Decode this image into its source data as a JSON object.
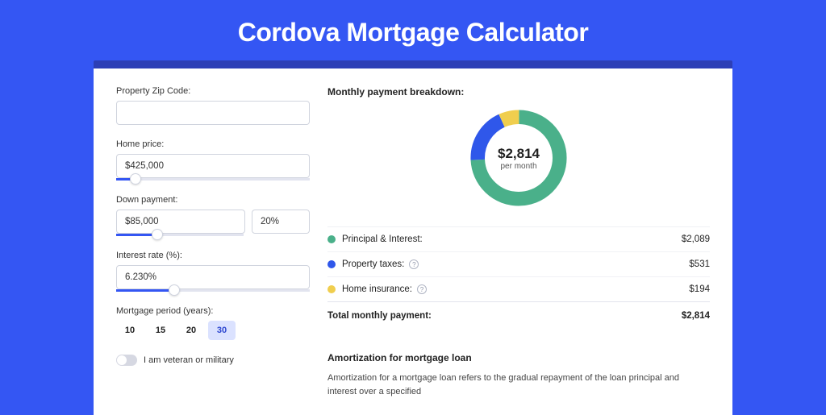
{
  "title": "Cordova Mortgage Calculator",
  "form": {
    "zip_label": "Property Zip Code:",
    "zip_value": "",
    "home_price_label": "Home price:",
    "home_price_value": "$425,000",
    "down_payment_label": "Down payment:",
    "down_payment_value": "$85,000",
    "down_payment_pct": "20%",
    "rate_label": "Interest rate (%):",
    "rate_value": "6.230%",
    "period_label": "Mortgage period (years):",
    "period_options": [
      "10",
      "15",
      "20",
      "30"
    ],
    "period_selected": "30",
    "veteran_label": "I am veteran or military"
  },
  "breakdown": {
    "header": "Monthly payment breakdown:",
    "total_amount": "$2,814",
    "per_month": "per month",
    "items": [
      {
        "label": "Principal & Interest:",
        "value": "$2,089",
        "color": "#4ab08a",
        "info": false
      },
      {
        "label": "Property taxes:",
        "value": "$531",
        "color": "#2f57ea",
        "info": true
      },
      {
        "label": "Home insurance:",
        "value": "$194",
        "color": "#f0ce4e",
        "info": true
      }
    ],
    "total_label": "Total monthly payment:",
    "total_value": "$2,814"
  },
  "chart_data": {
    "type": "pie",
    "title": "Monthly payment breakdown",
    "series": [
      {
        "name": "Principal & Interest",
        "value": 2089,
        "color": "#4ab08a"
      },
      {
        "name": "Property taxes",
        "value": 531,
        "color": "#2f57ea"
      },
      {
        "name": "Home insurance",
        "value": 194,
        "color": "#f0ce4e"
      }
    ],
    "total": 2814,
    "center_label": "$2,814",
    "center_sublabel": "per month"
  },
  "amortization": {
    "title": "Amortization for mortgage loan",
    "text": "Amortization for a mortgage loan refers to the gradual repayment of the loan principal and interest over a specified"
  }
}
